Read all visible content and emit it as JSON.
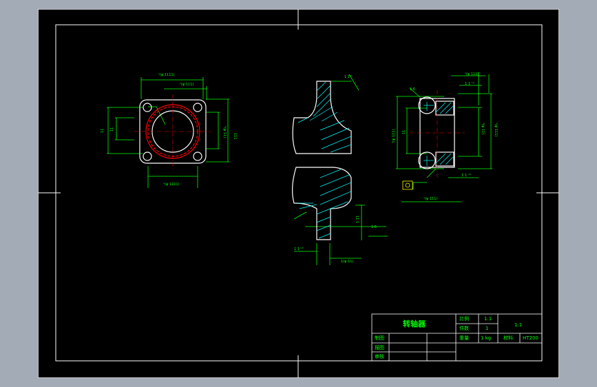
{
  "drawing": {
    "part_name": "转轴器",
    "scale_label": "比例",
    "scale_value": "1:1",
    "quantity_label": "件数",
    "quantity_value": "1",
    "weight_label": "重量",
    "weight_value": "1 kg",
    "material_label": "材料",
    "material_value": "HT200",
    "sheet_ref": "1:1",
    "designer_label": "制图",
    "checker_label": "描图",
    "reviewer_label": "审核"
  },
  "colors": {
    "background": "#000000",
    "frame": "#ffffff",
    "dimension": "#00ff00",
    "part": "#ffffff",
    "hatch": "#00ffff",
    "thread": "#ff0000"
  },
  "dims": {
    "plan_top_outer": "ⁿ(φ 1111)",
    "plan_top_inner": "ⁿ(φ 111)",
    "plan_left_outer": "11",
    "plan_left_inner": "11",
    "plan_right_outer": "111",
    "plan_right_inner": "ⁿ(φ 11)",
    "plan_bottom": "ⁿ(φ 1111)",
    "sec_top": "1 1°",
    "sec_bottom_left": "1 1 ⁿ°",
    "sec_bottom_right": "1(φ 11)",
    "sec_right": "11 1",
    "sec_rough": "1.6",
    "side_top_outer": "ⁿ(φ 111)",
    "side_top_inner": "1 1 ⁿ°",
    "side_left_outer": "ⁿ(φ 111)",
    "side_left_inner": "11",
    "side_right_outer": "ⁿ(φ 111)",
    "side_right_inner": "ⁿ(φ 11)",
    "side_bottom": "ⁿ(φ 111)",
    "side_note": "1 1 ⁿ°",
    "side_rough": "1.6"
  }
}
